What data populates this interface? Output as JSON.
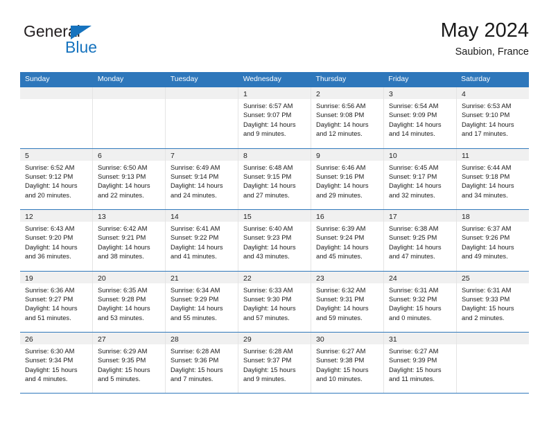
{
  "brand": {
    "name_part1": "General",
    "name_part2": "Blue",
    "triangle_color": "#1673be"
  },
  "header": {
    "title": "May 2024",
    "subtitle": "Saubion, France",
    "accent_color": "#2e77bb"
  },
  "calendar": {
    "day_headers": [
      "Sunday",
      "Monday",
      "Tuesday",
      "Wednesday",
      "Thursday",
      "Friday",
      "Saturday"
    ],
    "weeks": [
      [
        {
          "day": "",
          "lines": []
        },
        {
          "day": "",
          "lines": []
        },
        {
          "day": "",
          "lines": []
        },
        {
          "day": "1",
          "lines": [
            "Sunrise: 6:57 AM",
            "Sunset: 9:07 PM",
            "Daylight: 14 hours",
            "and 9 minutes."
          ]
        },
        {
          "day": "2",
          "lines": [
            "Sunrise: 6:56 AM",
            "Sunset: 9:08 PM",
            "Daylight: 14 hours",
            "and 12 minutes."
          ]
        },
        {
          "day": "3",
          "lines": [
            "Sunrise: 6:54 AM",
            "Sunset: 9:09 PM",
            "Daylight: 14 hours",
            "and 14 minutes."
          ]
        },
        {
          "day": "4",
          "lines": [
            "Sunrise: 6:53 AM",
            "Sunset: 9:10 PM",
            "Daylight: 14 hours",
            "and 17 minutes."
          ]
        }
      ],
      [
        {
          "day": "5",
          "lines": [
            "Sunrise: 6:52 AM",
            "Sunset: 9:12 PM",
            "Daylight: 14 hours",
            "and 20 minutes."
          ]
        },
        {
          "day": "6",
          "lines": [
            "Sunrise: 6:50 AM",
            "Sunset: 9:13 PM",
            "Daylight: 14 hours",
            "and 22 minutes."
          ]
        },
        {
          "day": "7",
          "lines": [
            "Sunrise: 6:49 AM",
            "Sunset: 9:14 PM",
            "Daylight: 14 hours",
            "and 24 minutes."
          ]
        },
        {
          "day": "8",
          "lines": [
            "Sunrise: 6:48 AM",
            "Sunset: 9:15 PM",
            "Daylight: 14 hours",
            "and 27 minutes."
          ]
        },
        {
          "day": "9",
          "lines": [
            "Sunrise: 6:46 AM",
            "Sunset: 9:16 PM",
            "Daylight: 14 hours",
            "and 29 minutes."
          ]
        },
        {
          "day": "10",
          "lines": [
            "Sunrise: 6:45 AM",
            "Sunset: 9:17 PM",
            "Daylight: 14 hours",
            "and 32 minutes."
          ]
        },
        {
          "day": "11",
          "lines": [
            "Sunrise: 6:44 AM",
            "Sunset: 9:18 PM",
            "Daylight: 14 hours",
            "and 34 minutes."
          ]
        }
      ],
      [
        {
          "day": "12",
          "lines": [
            "Sunrise: 6:43 AM",
            "Sunset: 9:20 PM",
            "Daylight: 14 hours",
            "and 36 minutes."
          ]
        },
        {
          "day": "13",
          "lines": [
            "Sunrise: 6:42 AM",
            "Sunset: 9:21 PM",
            "Daylight: 14 hours",
            "and 38 minutes."
          ]
        },
        {
          "day": "14",
          "lines": [
            "Sunrise: 6:41 AM",
            "Sunset: 9:22 PM",
            "Daylight: 14 hours",
            "and 41 minutes."
          ]
        },
        {
          "day": "15",
          "lines": [
            "Sunrise: 6:40 AM",
            "Sunset: 9:23 PM",
            "Daylight: 14 hours",
            "and 43 minutes."
          ]
        },
        {
          "day": "16",
          "lines": [
            "Sunrise: 6:39 AM",
            "Sunset: 9:24 PM",
            "Daylight: 14 hours",
            "and 45 minutes."
          ]
        },
        {
          "day": "17",
          "lines": [
            "Sunrise: 6:38 AM",
            "Sunset: 9:25 PM",
            "Daylight: 14 hours",
            "and 47 minutes."
          ]
        },
        {
          "day": "18",
          "lines": [
            "Sunrise: 6:37 AM",
            "Sunset: 9:26 PM",
            "Daylight: 14 hours",
            "and 49 minutes."
          ]
        }
      ],
      [
        {
          "day": "19",
          "lines": [
            "Sunrise: 6:36 AM",
            "Sunset: 9:27 PM",
            "Daylight: 14 hours",
            "and 51 minutes."
          ]
        },
        {
          "day": "20",
          "lines": [
            "Sunrise: 6:35 AM",
            "Sunset: 9:28 PM",
            "Daylight: 14 hours",
            "and 53 minutes."
          ]
        },
        {
          "day": "21",
          "lines": [
            "Sunrise: 6:34 AM",
            "Sunset: 9:29 PM",
            "Daylight: 14 hours",
            "and 55 minutes."
          ]
        },
        {
          "day": "22",
          "lines": [
            "Sunrise: 6:33 AM",
            "Sunset: 9:30 PM",
            "Daylight: 14 hours",
            "and 57 minutes."
          ]
        },
        {
          "day": "23",
          "lines": [
            "Sunrise: 6:32 AM",
            "Sunset: 9:31 PM",
            "Daylight: 14 hours",
            "and 59 minutes."
          ]
        },
        {
          "day": "24",
          "lines": [
            "Sunrise: 6:31 AM",
            "Sunset: 9:32 PM",
            "Daylight: 15 hours",
            "and 0 minutes."
          ]
        },
        {
          "day": "25",
          "lines": [
            "Sunrise: 6:31 AM",
            "Sunset: 9:33 PM",
            "Daylight: 15 hours",
            "and 2 minutes."
          ]
        }
      ],
      [
        {
          "day": "26",
          "lines": [
            "Sunrise: 6:30 AM",
            "Sunset: 9:34 PM",
            "Daylight: 15 hours",
            "and 4 minutes."
          ]
        },
        {
          "day": "27",
          "lines": [
            "Sunrise: 6:29 AM",
            "Sunset: 9:35 PM",
            "Daylight: 15 hours",
            "and 5 minutes."
          ]
        },
        {
          "day": "28",
          "lines": [
            "Sunrise: 6:28 AM",
            "Sunset: 9:36 PM",
            "Daylight: 15 hours",
            "and 7 minutes."
          ]
        },
        {
          "day": "29",
          "lines": [
            "Sunrise: 6:28 AM",
            "Sunset: 9:37 PM",
            "Daylight: 15 hours",
            "and 9 minutes."
          ]
        },
        {
          "day": "30",
          "lines": [
            "Sunrise: 6:27 AM",
            "Sunset: 9:38 PM",
            "Daylight: 15 hours",
            "and 10 minutes."
          ]
        },
        {
          "day": "31",
          "lines": [
            "Sunrise: 6:27 AM",
            "Sunset: 9:39 PM",
            "Daylight: 15 hours",
            "and 11 minutes."
          ]
        },
        {
          "day": "",
          "lines": []
        }
      ]
    ]
  }
}
